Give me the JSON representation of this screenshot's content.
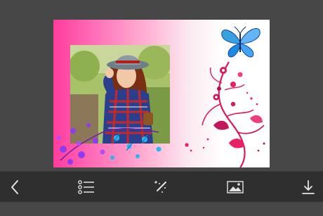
{
  "toolbar": {
    "items": [
      {
        "name": "back",
        "icon": "chevron-left-icon"
      },
      {
        "name": "frames-list",
        "icon": "list-icon"
      },
      {
        "name": "effects",
        "icon": "magic-wand-icon"
      },
      {
        "name": "gallery",
        "icon": "image-icon"
      },
      {
        "name": "save",
        "icon": "download-icon"
      }
    ]
  },
  "frame": {
    "accent_left": "#ff3c9c",
    "accent_right": "#ffffff",
    "butterfly_color": "#2a8fd6",
    "floral_color": "#d81b60",
    "violet_color": "#8e3cf0"
  },
  "colors": {
    "background": "#474747",
    "toolbar": "#2f2f2f",
    "icon": "#e6e6e6"
  }
}
